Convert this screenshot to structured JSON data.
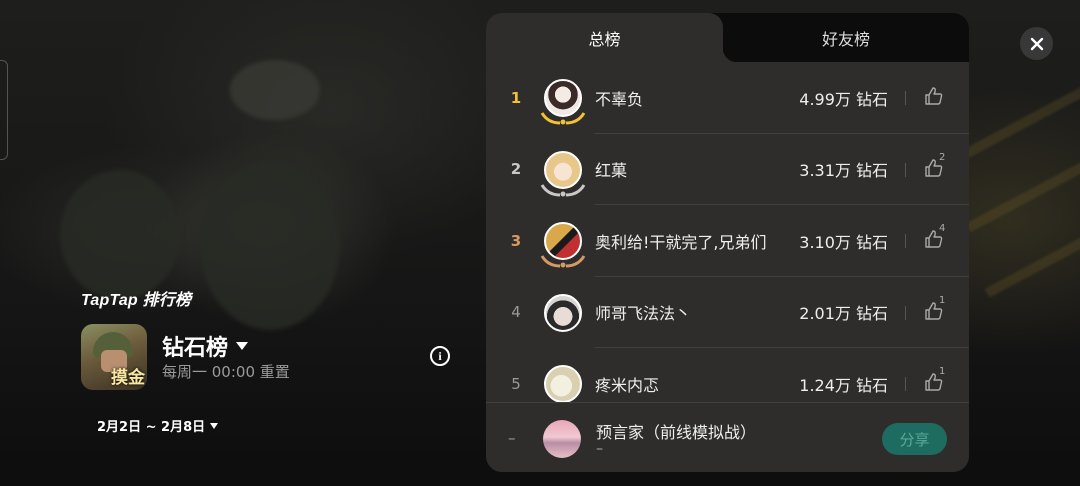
{
  "header": {
    "brand": "TapTap 排行榜"
  },
  "board": {
    "title": "钻石榜",
    "reset": "每周一 00:00 重置",
    "date_range": "2月2日 ~ 2月8日",
    "game_tag": "摸金"
  },
  "tabs": [
    {
      "label": "总榜",
      "active": true
    },
    {
      "label": "好友榜",
      "active": false
    }
  ],
  "rankings": [
    {
      "rank": "1",
      "name": "不辜负",
      "score": "4.99万 钻石",
      "likes": "",
      "avatar_color": "#f0e8e4"
    },
    {
      "rank": "2",
      "name": "红菓",
      "score": "3.31万 钻石",
      "likes": "2",
      "avatar_color": "#e8c89a"
    },
    {
      "rank": "3",
      "name": "奥利给!干就完了,兄弟们",
      "score": "3.10万 钻石",
      "likes": "4",
      "avatar_color": "#c9a03a"
    },
    {
      "rank": "4",
      "name": "师哥飞法法丶",
      "score": "2.01万 钻石",
      "likes": "1",
      "avatar_color": "#d8d4d0"
    },
    {
      "rank": "5",
      "name": "疼米内忑",
      "score": "1.24万 钻石",
      "likes": "1",
      "avatar_color": "#e6e0c8"
    }
  ],
  "self": {
    "rank": "–",
    "name": "预言家（前线模拟战）",
    "score": "–",
    "share_label": "分享"
  },
  "colors": {
    "gold": "#f2c232",
    "silver": "#c8c8c8",
    "bronze": "#d49a63",
    "share": "#1e6b60"
  }
}
